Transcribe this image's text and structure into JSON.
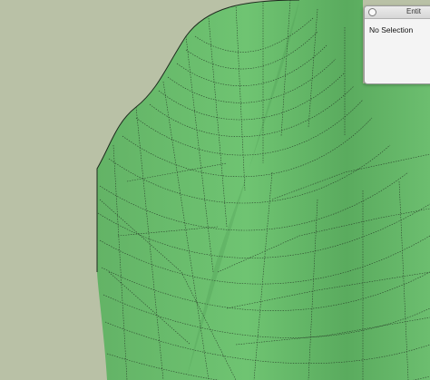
{
  "viewport": {
    "background": "#b9c1a6",
    "surface_color": "#6cbe6f",
    "surface_shadow_color": "#4e9a52",
    "edge_color": "#1e2a1e"
  },
  "entity_info": {
    "title": "Entit",
    "status": "No Selection"
  }
}
